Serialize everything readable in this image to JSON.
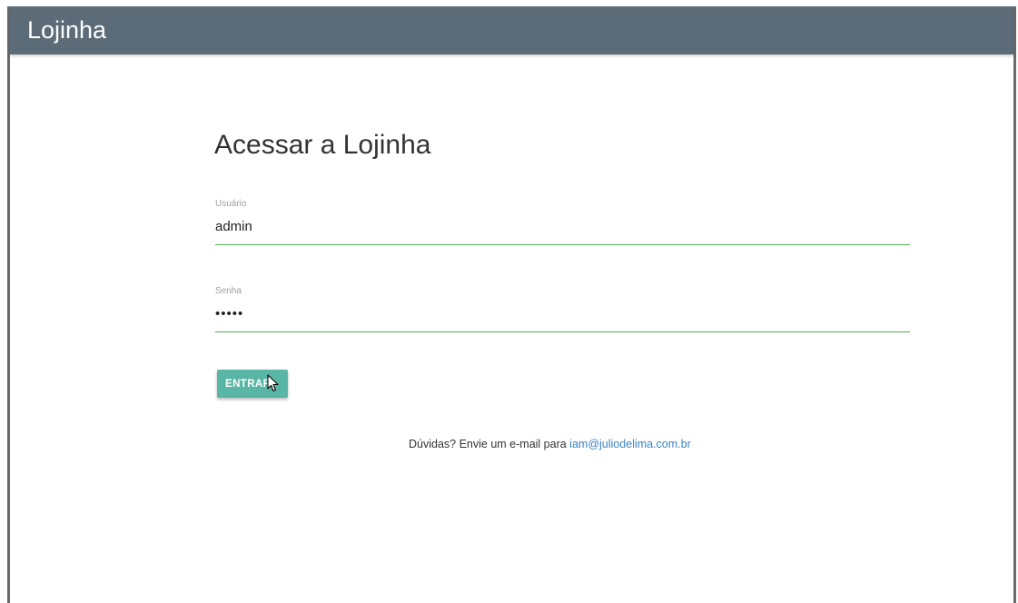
{
  "navbar": {
    "brand": "Lojinha"
  },
  "login": {
    "title": "Acessar a Lojinha",
    "user_label": "Usuário",
    "user_value": "admin",
    "pass_label": "Senha",
    "pass_value": "admin",
    "submit_label": "ENTRAR"
  },
  "help": {
    "text": "Dúvidas? Envie um e-mail para ",
    "email": "iam@juliodelima.com.br"
  },
  "colors": {
    "navbar": "#5b6b78",
    "button": "#5ab6a4",
    "input_underline": "#4caf50",
    "link": "#3b82c4"
  },
  "icons": {
    "cursor": "mouse-pointer-icon"
  }
}
